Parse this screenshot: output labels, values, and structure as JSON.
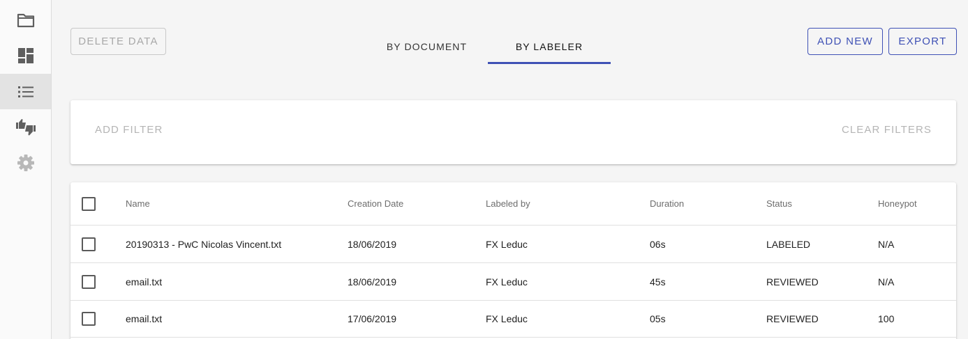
{
  "sidebar": {
    "items": [
      {
        "icon": "folder-icon"
      },
      {
        "icon": "dashboard-icon"
      },
      {
        "icon": "list-icon",
        "active": true
      },
      {
        "icon": "thumbs-icon"
      },
      {
        "icon": "settings-icon"
      }
    ]
  },
  "toolbar": {
    "delete_label": "DELETE DATA",
    "add_new_label": "ADD NEW",
    "export_label": "EXPORT"
  },
  "tabs": [
    {
      "label": "BY DOCUMENT",
      "active": false
    },
    {
      "label": "BY LABELER",
      "active": true
    }
  ],
  "filters": {
    "add_label": "ADD FILTER",
    "clear_label": "CLEAR FILTERS"
  },
  "table": {
    "columns": [
      "Name",
      "Creation Date",
      "Labeled by",
      "Duration",
      "Status",
      "Honeypot"
    ],
    "rows": [
      [
        "20190313 - PwC Nicolas Vincent.txt",
        "18/06/2019",
        "FX Leduc",
        "06s",
        "LABELED",
        "N/A"
      ],
      [
        "email.txt",
        "18/06/2019",
        "FX Leduc",
        "45s",
        "REVIEWED",
        "N/A"
      ],
      [
        "email.txt",
        "17/06/2019",
        "FX Leduc",
        "05s",
        "REVIEWED",
        "100"
      ]
    ]
  },
  "colors": {
    "accent": "#3f51b5",
    "disabled": "#a8a8a8",
    "background": "#f5f5f5"
  }
}
